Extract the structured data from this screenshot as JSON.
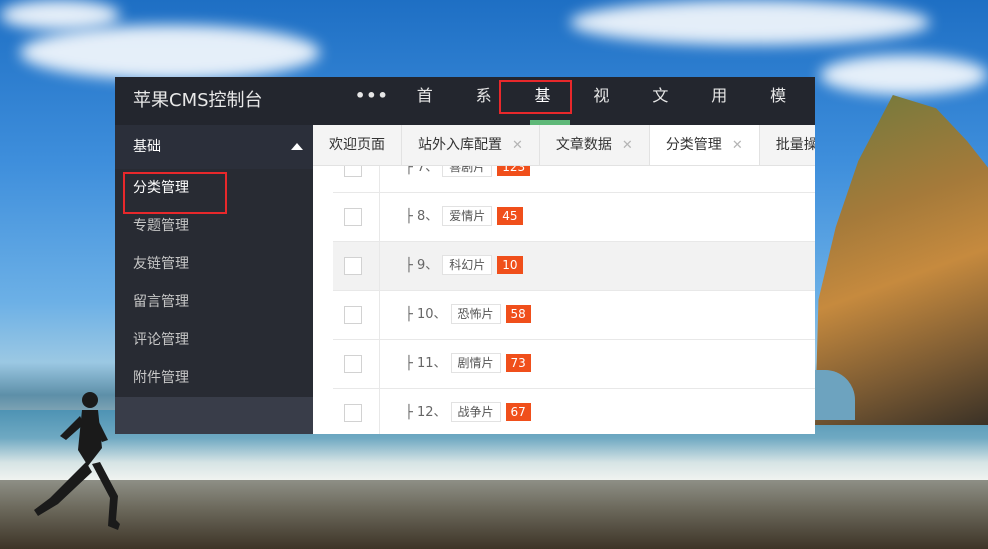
{
  "app": {
    "title": "苹果CMS控制台"
  },
  "topnav": {
    "more": "•••",
    "items": [
      "首页",
      "系统",
      "基础",
      "视频",
      "文章",
      "用户",
      "模版"
    ]
  },
  "sidebar": {
    "group": "基础",
    "items": [
      "分类管理",
      "专题管理",
      "友链管理",
      "留言管理",
      "评论管理",
      "附件管理"
    ]
  },
  "tabs": [
    {
      "label": "欢迎页面"
    },
    {
      "label": "站外入库配置",
      "close": "✕"
    },
    {
      "label": "文章数据",
      "close": "✕"
    },
    {
      "label": "分类管理",
      "close": "✕"
    },
    {
      "label": "批量操"
    }
  ],
  "rows": [
    {
      "prefix": "├ 7、",
      "name": "喜剧片",
      "count": "123"
    },
    {
      "prefix": "├ 8、",
      "name": "爱情片",
      "count": "45"
    },
    {
      "prefix": "├ 9、",
      "name": "科幻片",
      "count": "10"
    },
    {
      "prefix": "├ 10、",
      "name": "恐怖片",
      "count": "58"
    },
    {
      "prefix": "├ 11、",
      "name": "剧情片",
      "count": "73"
    },
    {
      "prefix": "├ 12、",
      "name": "战争片",
      "count": "67"
    }
  ],
  "colors": {
    "accent_green": "#5fb878",
    "badge_red": "#f04f1b",
    "highlight_red": "#e8282b"
  }
}
